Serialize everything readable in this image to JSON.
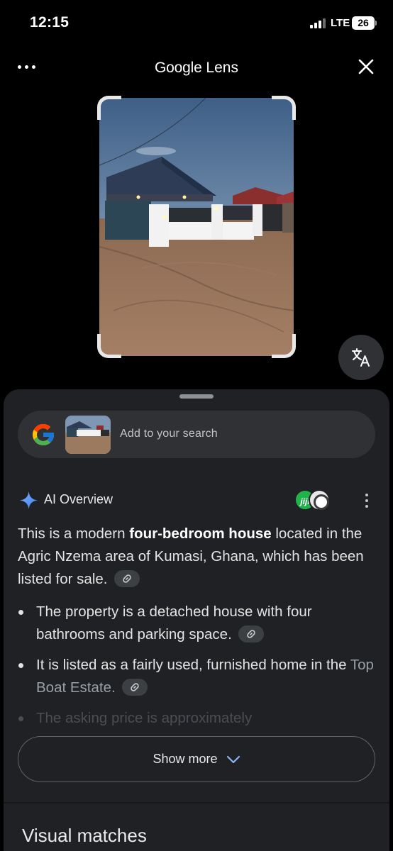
{
  "status_bar": {
    "time": "12:15",
    "network": "LTE",
    "battery": "26"
  },
  "header": {
    "title_brand": "Google",
    "title_product": "Lens"
  },
  "search": {
    "placeholder": "Add to your search"
  },
  "ai_overview": {
    "title": "AI Overview",
    "source_badge": "jiji",
    "intro_start": "This is a modern ",
    "intro_bold": "four-bedroom house",
    "intro_end": " located in the Agric Nzema area of Kumasi, Ghana, which has been listed for sale.",
    "bullets": [
      {
        "text": "The property is a detached house with four bathrooms and parking space."
      },
      {
        "text": "It is listed as a fairly used, furnished home in the ",
        "text_faded": "Top Boat Estate."
      },
      {
        "text": "The asking price is approximately"
      }
    ],
    "show_more_label": "Show more"
  },
  "visual_matches": {
    "title": "Visual matches"
  },
  "colors": {
    "background": "#000000",
    "sheet": "#202124",
    "pill": "#303134",
    "accent_blue": "#4285f4",
    "jiji_green": "#22b24c"
  },
  "icons": [
    "more-horizontal-icon",
    "close-icon",
    "translate-icon",
    "google-g-icon",
    "sparkle-icon",
    "link-icon",
    "kebab-icon",
    "chevron-down-icon"
  ]
}
